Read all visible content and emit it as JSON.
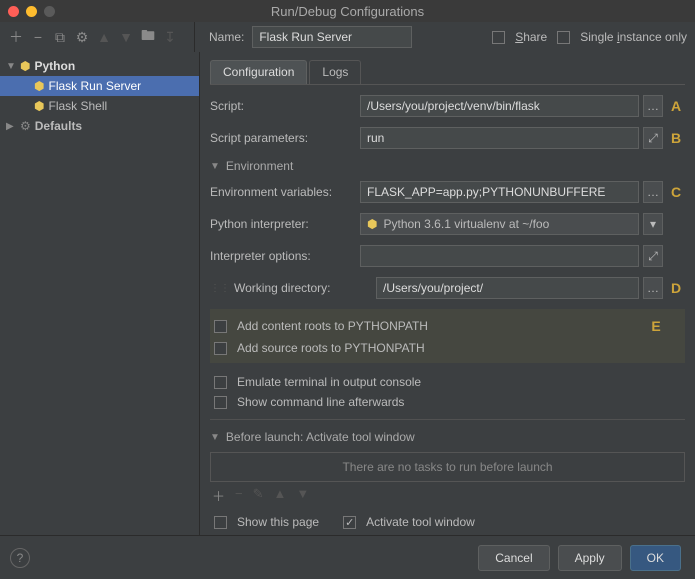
{
  "window": {
    "title": "Run/Debug Configurations"
  },
  "topbar": {
    "name_label": "Name:",
    "name_value": "Flask Run Server",
    "share_label": "Share",
    "single_instance_label": "Single instance only"
  },
  "sidebar": {
    "root": {
      "label": "Python"
    },
    "children": [
      {
        "label": "Flask Run Server",
        "selected": true
      },
      {
        "label": "Flask Shell",
        "selected": false
      }
    ],
    "defaults": {
      "label": "Defaults"
    }
  },
  "tabs": {
    "config": "Configuration",
    "logs": "Logs"
  },
  "form": {
    "script_label": "Script:",
    "script_value": "/Users/you/project/venv/bin/flask",
    "script_params_label": "Script parameters:",
    "script_params_value": "run",
    "env_section": "Environment",
    "env_vars_label": "Environment variables:",
    "env_vars_value": "FLASK_APP=app.py;PYTHONUNBUFFERE",
    "interpreter_label": "Python interpreter:",
    "interpreter_value": "Python 3.6.1 virtualenv at ~/foo",
    "interpreter_opts_label": "Interpreter options:",
    "interpreter_opts_value": "",
    "working_dir_label": "Working directory:",
    "working_dir_value": "/Users/you/project/",
    "add_content_roots": "Add content roots to PYTHONPATH",
    "add_source_roots": "Add source roots to PYTHONPATH",
    "emulate_terminal": "Emulate terminal in output console",
    "show_cmdline": "Show command line afterwards"
  },
  "before_launch": {
    "header": "Before launch: Activate tool window",
    "empty_msg": "There are no tasks to run before launch",
    "show_this_page": "Show this page",
    "activate_tool": "Activate tool window"
  },
  "callouts": {
    "a": "A",
    "b": "B",
    "c": "C",
    "d": "D",
    "e": "E"
  },
  "buttons": {
    "cancel": "Cancel",
    "apply": "Apply",
    "ok": "OK"
  }
}
